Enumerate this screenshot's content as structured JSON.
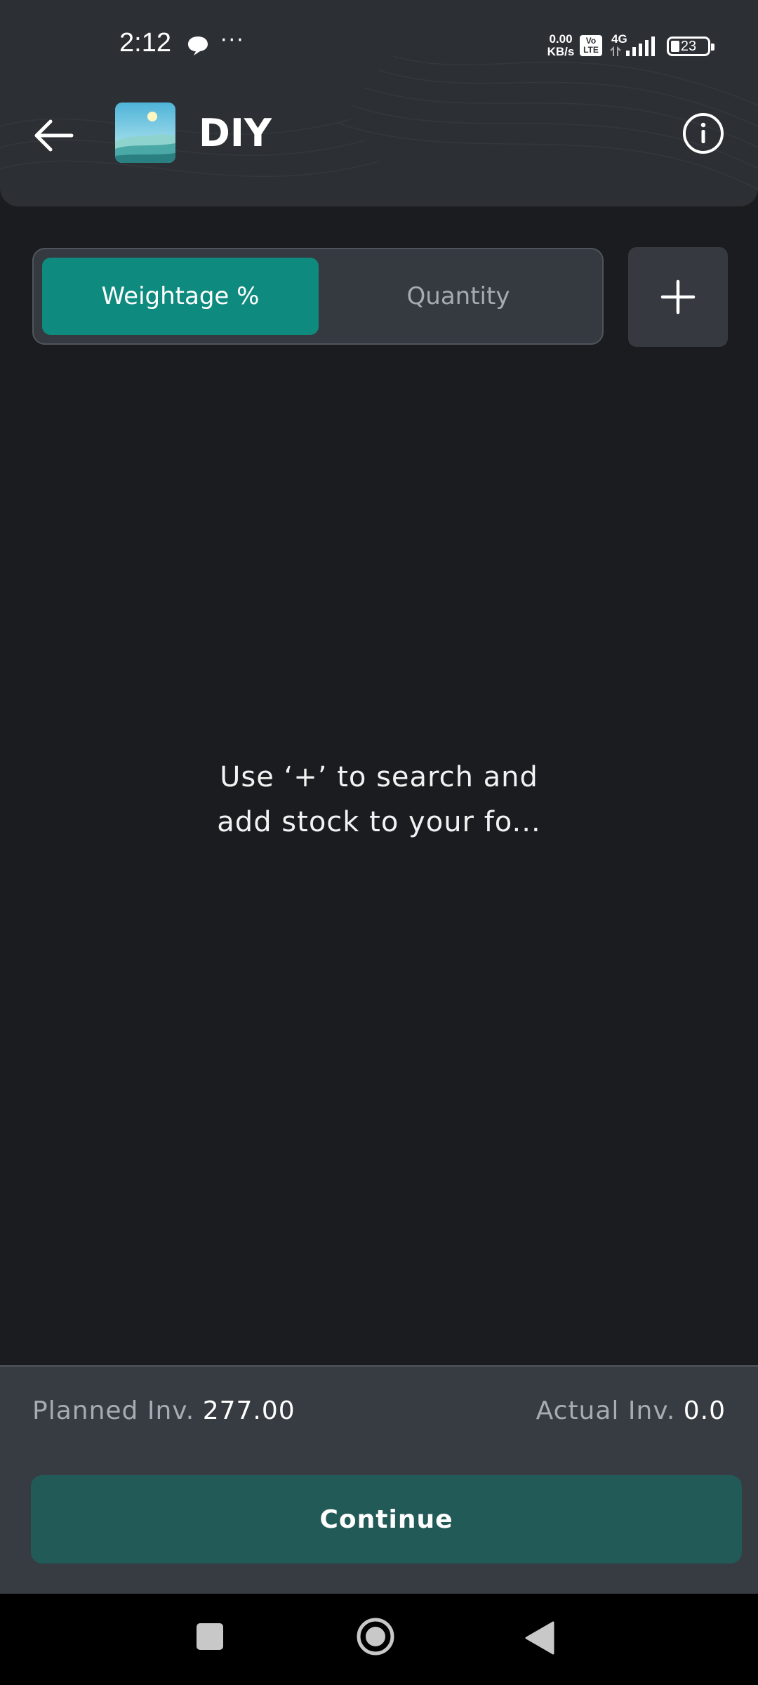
{
  "status_bar": {
    "time": "2:12",
    "dots": "···",
    "net_speed_value": "0.00",
    "net_speed_unit": "KB/s",
    "volte_top": "Vo",
    "volte_bottom": "LTE",
    "network": "4G",
    "battery": "23"
  },
  "header": {
    "title": "DIY",
    "back_icon": "arrow-left-icon",
    "info_icon": "info-icon"
  },
  "mode_toggle": {
    "tabs": [
      {
        "label": "Weightage %",
        "active": true
      },
      {
        "label": "Quantity",
        "active": false
      }
    ]
  },
  "add_button_icon": "plus-icon",
  "empty_state": {
    "line1": "Use ‘+’ to search and",
    "line2": "add stock to your fo..."
  },
  "summary": {
    "planned_label": "Planned Inv.",
    "planned_value": "277.00",
    "actual_label": "Actual Inv.",
    "actual_value": "0.0"
  },
  "continue_label": "Continue",
  "colors": {
    "accent": "#0f8a7e",
    "continue_bg": "#225a57",
    "background": "#1b1c1f"
  }
}
